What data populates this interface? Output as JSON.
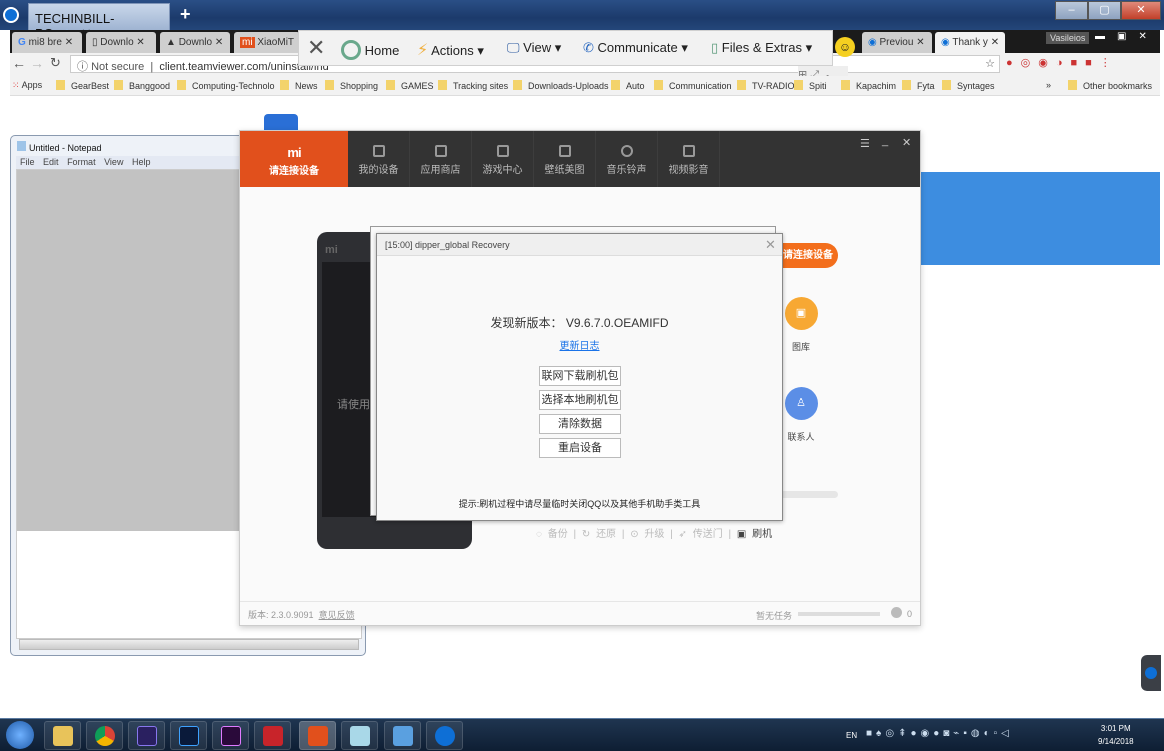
{
  "teamviewer": {
    "session_tab": "TECHINBILL-PC",
    "toolbar": {
      "home": "Home",
      "actions": "Actions",
      "view": "View",
      "communicate": "Communicate",
      "files_extras": "Files & Extras"
    }
  },
  "chrome": {
    "tabs": [
      {
        "label": "mi8 bre"
      },
      {
        "label": "Downlo"
      },
      {
        "label": "Downlo"
      },
      {
        "label": "XiaoMiT"
      },
      {
        "label": "Previou"
      },
      {
        "label": "Thank y"
      }
    ],
    "profile": "Vasileios",
    "not_secure": "Not secure",
    "url": "client.teamviewer.com/uninstall/ind",
    "bookmarks": [
      "Apps",
      "GearBest",
      "Banggood",
      "Computing-Technolo",
      "News",
      "Shopping",
      "GAMES",
      "Tracking sites",
      "Downloads-Uploads",
      "Auto",
      "Communication",
      "TV-RADIO",
      "Spiti",
      "Kapachim",
      "Fyta",
      "Syntages"
    ],
    "more": "»",
    "other_bookmarks": "Other bookmarks"
  },
  "notepad": {
    "title": "Untitled - Notepad",
    "menu": [
      "File",
      "Edit",
      "Format",
      "View",
      "Help"
    ]
  },
  "miflash": {
    "brand_logo": "mi",
    "brand_label": "请连接设备",
    "nav": [
      "我的设备",
      "应用商店",
      "游戏中心",
      "壁纸美图",
      "音乐铃声",
      "视频影音"
    ],
    "phone_text": "请使用",
    "connect_button": "请连接设备",
    "side_items": [
      {
        "label": "图库",
        "color": "#f7a833"
      },
      {
        "label": "联系人",
        "color": "#5b8ee6"
      }
    ],
    "actions": [
      "备份",
      "还原",
      "升级",
      "传送门",
      "刷机"
    ],
    "version": "版本: 2.3.0.9091",
    "feedback": "意见反馈",
    "task_status": "暂无任务",
    "task_count": "0"
  },
  "dialog": {
    "title": "[15:00] dipper_global Recovery",
    "new_version_label": "发现新版本：",
    "new_version": "V9.6.7.0.OEAMIFD",
    "changelog_link": "更新日志",
    "buttons": [
      "联网下载刷机包",
      "选择本地刷机包",
      "清除数据",
      "重启设备"
    ],
    "tip": "提示:刷机过程中请尽量临时关闭QQ以及其他手机助手类工具"
  },
  "taskbar": {
    "apps": [
      "explorer",
      "chrome",
      "vs",
      "photoshop",
      "premiere",
      "toolbox",
      "miflash",
      "notes",
      "remote-desktop",
      "teamviewer"
    ],
    "lang": "EN",
    "time": "3:01 PM",
    "date": "9/14/2018"
  }
}
